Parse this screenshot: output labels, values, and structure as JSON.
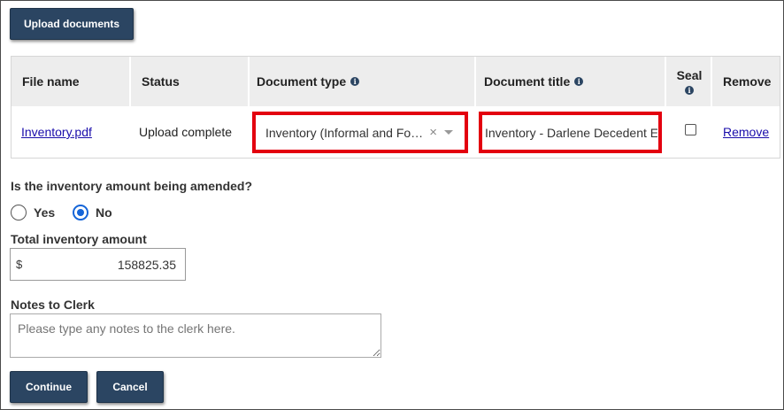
{
  "toolbar": {
    "upload_label": "Upload documents"
  },
  "table": {
    "headers": {
      "file_name": "File name",
      "status": "Status",
      "document_type": "Document type",
      "document_title": "Document title",
      "seal": "Seal",
      "remove": "Remove"
    },
    "rows": [
      {
        "file_name": "Inventory.pdf",
        "status": "Upload complete",
        "document_type": "Inventory (Informal and Fo…",
        "document_title": "Inventory - Darlene Decedent E",
        "seal_checked": false,
        "remove": "Remove"
      }
    ]
  },
  "amended": {
    "question": "Is the inventory amount being amended?",
    "options": [
      "Yes",
      "No"
    ],
    "selected": "No"
  },
  "total": {
    "label": "Total inventory amount",
    "currency": "$",
    "value": "158825.35"
  },
  "notes": {
    "label": "Notes to Clerk",
    "placeholder": "Please type any notes to the clerk here."
  },
  "actions": {
    "continue": "Continue",
    "cancel": "Cancel"
  },
  "icons": {
    "info": "info-icon",
    "clear": "clear-icon",
    "dropdown": "caret-down-icon"
  },
  "colors": {
    "button_bg": "#2b4562",
    "highlight": "#e3000f",
    "link": "#1a0dab",
    "radio_selected": "#1565d8"
  }
}
